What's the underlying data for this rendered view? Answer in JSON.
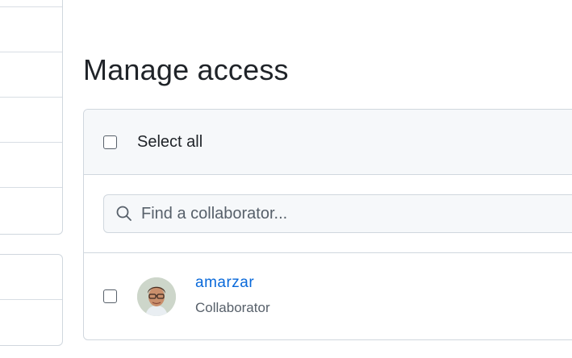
{
  "page": {
    "title": "Manage access"
  },
  "panel": {
    "select_all_label": "Select all",
    "search": {
      "placeholder": "Find a collaborator...",
      "value": "",
      "icon": "search-icon"
    },
    "members": [
      {
        "username": "amarzar",
        "role": "Collaborator"
      }
    ]
  },
  "colors": {
    "link": "#0969da",
    "border": "#d0d7de",
    "header_bg": "#f6f8fa",
    "muted_text": "#57606a"
  }
}
